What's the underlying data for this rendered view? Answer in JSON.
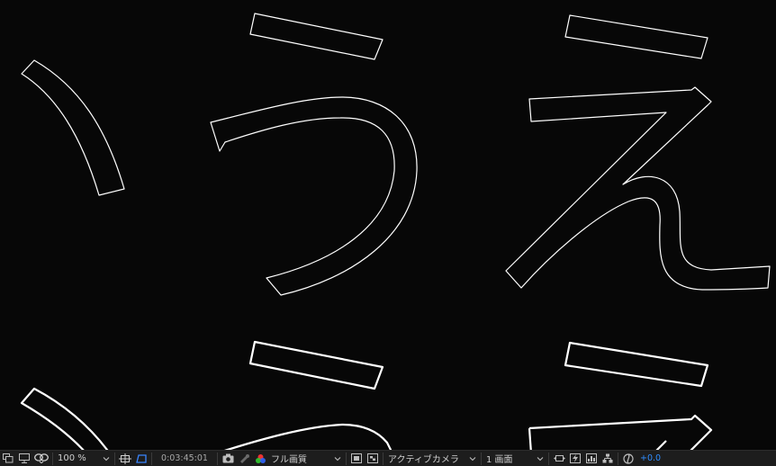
{
  "viewer": {
    "background": "#070707",
    "stroke": "#ffffff"
  },
  "toolbar": {
    "zoom_value": "100 %",
    "timecode": "0:03:45:01",
    "resolution_value": "フル画質",
    "camera_value": "アクティブカメラ",
    "views_value": "1 画面",
    "exposure_value": "+0.0",
    "accent": "#2f8dff",
    "icons": [
      "always-preview-icon",
      "monitor-icon",
      "mask-icon",
      "zoom-dropdown",
      "safe-areas-icon",
      "mask-path-icon",
      "snapshot-icon",
      "show-snapshot-icon",
      "color-channels-icon",
      "fast-previews-icon",
      "transparency-grid-icon",
      "reset-exposure-icon"
    ]
  }
}
